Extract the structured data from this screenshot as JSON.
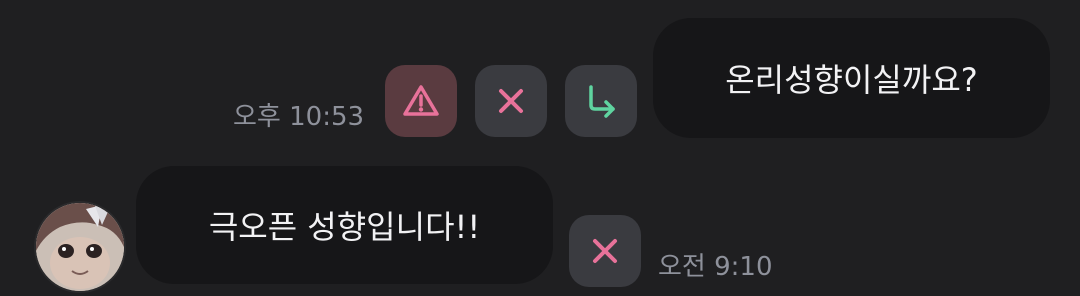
{
  "messages": {
    "outgoing": {
      "text": "온리성향이실까요?",
      "time": "오후 10:53"
    },
    "incoming": {
      "text": "극오픈 성향입니다!!",
      "time": "오전 9:10"
    }
  },
  "icons": {
    "warn": "warning-icon",
    "cancel": "close-icon",
    "reply": "reply-arrow-icon"
  },
  "colors": {
    "background": "#1f1f21",
    "bubble": "#161618",
    "warn_btn": "#5a3b40",
    "neutral_btn": "#3a3b40",
    "pink_icon": "#e8729a",
    "green_icon": "#5fd4a0",
    "timestamp": "#8e919b"
  }
}
